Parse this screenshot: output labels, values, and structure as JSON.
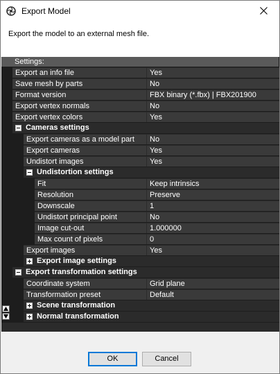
{
  "window": {
    "title": "Export Model",
    "icon": "app-lens-icon",
    "close_icon": "close-icon"
  },
  "description": "Export the model to an external mesh file.",
  "grid": {
    "header": "Settings:",
    "rows": [
      {
        "type": "prop",
        "level": 0,
        "label": "Export an info file",
        "value": "Yes"
      },
      {
        "type": "prop",
        "level": 0,
        "label": "Save mesh by parts",
        "value": "No"
      },
      {
        "type": "prop",
        "level": 0,
        "label": "Format version",
        "value": "FBX binary (*.fbx) | FBX201900"
      },
      {
        "type": "prop",
        "level": 0,
        "label": "Export vertex normals",
        "value": "No"
      },
      {
        "type": "prop",
        "level": 0,
        "label": "Export vertex colors",
        "value": "Yes"
      },
      {
        "type": "cat",
        "level": 0,
        "label": "Cameras settings",
        "expanded": true
      },
      {
        "type": "prop",
        "level": 1,
        "label": "Export cameras as a model part",
        "value": "No"
      },
      {
        "type": "prop",
        "level": 1,
        "label": "Export cameras",
        "value": "Yes"
      },
      {
        "type": "prop",
        "level": 1,
        "label": "Undistort images",
        "value": "Yes"
      },
      {
        "type": "cat",
        "level": 1,
        "label": "Undistortion settings",
        "expanded": true
      },
      {
        "type": "prop",
        "level": 2,
        "label": "Fit",
        "value": "Keep intrinsics"
      },
      {
        "type": "prop",
        "level": 2,
        "label": "Resolution",
        "value": "Preserve"
      },
      {
        "type": "prop",
        "level": 2,
        "label": "Downscale",
        "value": "1"
      },
      {
        "type": "prop",
        "level": 2,
        "label": "Undistort principal point",
        "value": "No"
      },
      {
        "type": "prop",
        "level": 2,
        "label": "Image cut-out",
        "value": "1.000000"
      },
      {
        "type": "prop",
        "level": 2,
        "label": "Max count of pixels",
        "value": "0"
      },
      {
        "type": "prop",
        "level": 1,
        "label": "Export images",
        "value": "Yes"
      },
      {
        "type": "cat",
        "level": 1,
        "label": "Export image settings",
        "expanded": false
      },
      {
        "type": "cat",
        "level": 0,
        "label": "Export transformation settings",
        "expanded": true
      },
      {
        "type": "prop",
        "level": 1,
        "label": "Coordinate system",
        "value": "Grid plane"
      },
      {
        "type": "prop",
        "level": 1,
        "label": "Transformation preset",
        "value": "Default"
      },
      {
        "type": "cat",
        "level": 1,
        "label": "Scene transformation",
        "expanded": false
      },
      {
        "type": "cat",
        "level": 1,
        "label": "Normal transformation",
        "expanded": false
      }
    ]
  },
  "buttons": {
    "ok": "OK",
    "cancel": "Cancel"
  }
}
